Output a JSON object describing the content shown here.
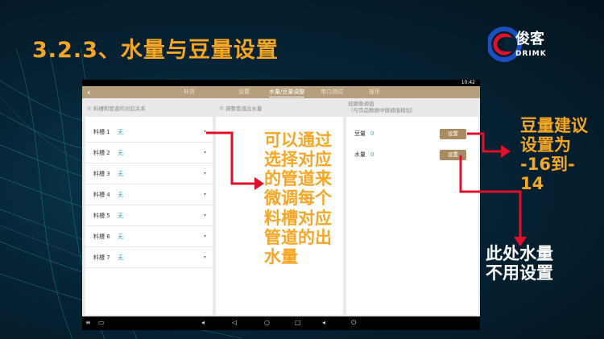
{
  "slide": {
    "title": "3.2.3、水量与豆量设置",
    "logo_cn": "俊客",
    "logo_en": "DRIMK"
  },
  "device": {
    "time": "10:42",
    "tabs": [
      {
        "label": "补货",
        "active": false
      },
      {
        "label": "设置",
        "active": false
      },
      {
        "label": "水量/豆量调整",
        "active": true
      },
      {
        "label": "串口测试",
        "active": false
      },
      {
        "label": "报币",
        "active": false
      }
    ],
    "col1_header": "① 料槽和管道的对应关系",
    "col2_header": "② 调整管道出水量",
    "col3_header_1": "现磨微调值",
    "col3_header_2": "（与饮品数据中微调值相加）",
    "troughs": [
      {
        "label": "料槽 1",
        "value": "无"
      },
      {
        "label": "料槽 2",
        "value": "无"
      },
      {
        "label": "料槽 3",
        "value": "无"
      },
      {
        "label": "料槽 4",
        "value": "无"
      },
      {
        "label": "料槽 5",
        "value": "无"
      },
      {
        "label": "料槽 6",
        "value": "无"
      },
      {
        "label": "料槽 7",
        "value": "无"
      }
    ],
    "settings": [
      {
        "label": "豆量",
        "value": "0",
        "button": "设置"
      },
      {
        "label": "水量",
        "value": "0",
        "button": "设置"
      }
    ]
  },
  "annotations": {
    "center_lines": [
      "可以通过",
      "选择对应",
      "的管道来",
      "微调每个",
      "料槽对应",
      "管道的出",
      "水量"
    ],
    "right_lines": [
      "豆量建议",
      "设置为",
      "-16到-",
      "14"
    ],
    "bottom_lines": [
      "此处水量",
      "不用设置"
    ]
  },
  "colors": {
    "title": "#f5a623",
    "accent_bar": "#b69f7c",
    "button": "#a78b63",
    "value": "#2aa7c9",
    "arrow": "#e0102a"
  }
}
